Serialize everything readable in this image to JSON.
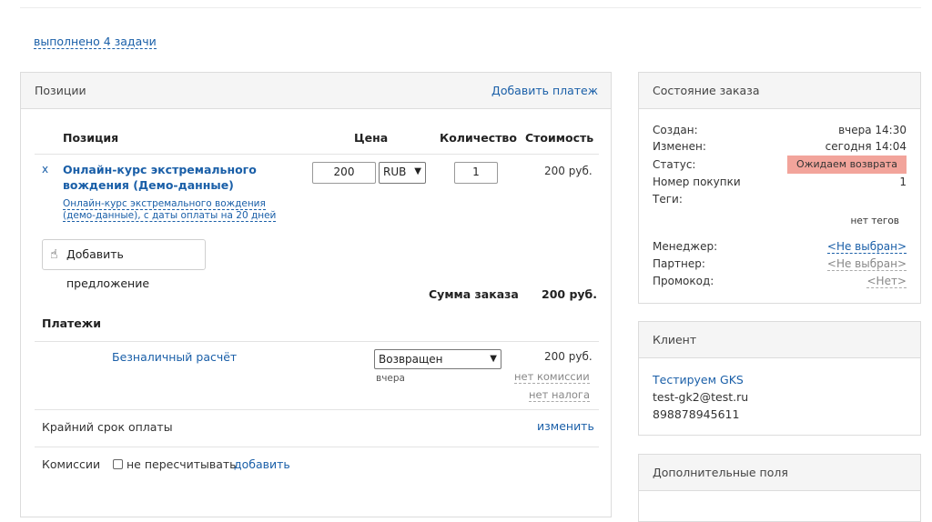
{
  "tasks_link": "выполнено 4 задачи",
  "positions": {
    "title": "Позиции",
    "add_payment": "Добавить платеж",
    "headers": {
      "position": "Позиция",
      "price": "Цена",
      "quantity": "Количество",
      "cost": "Стоимость"
    },
    "item": {
      "remove": "x",
      "name": "Онлайн-курс экстремального вождения (Демо-данные)",
      "description": "Онлайн-курс экстремального вождения (демо-данные), с даты оплаты на 20 дней",
      "price": "200",
      "currency": "RUB",
      "quantity": "1",
      "cost": "200 руб."
    },
    "add_offer": "Добавить предложение",
    "total_label": "Сумма заказа",
    "total_value": "200 руб."
  },
  "payments": {
    "title": "Платежи",
    "method": "Безналичный расчёт",
    "status": "Возвращен",
    "date": "вчера",
    "amount": "200 руб.",
    "commission": "нет комиссии",
    "tax": "нет налога"
  },
  "deadline": {
    "label": "Крайний срок оплаты",
    "action": "изменить"
  },
  "commissions": {
    "label": "Комиссии",
    "checkbox_label": "не пересчитывать",
    "add": "добавить"
  },
  "order_state": {
    "title": "Состояние заказа",
    "created_label": "Создан:",
    "created_value": "вчера 14:30",
    "changed_label": "Изменен:",
    "changed_value": "сегодня 14:04",
    "status_label": "Статус:",
    "status_value": "Ожидаем возврата",
    "purchase_label": "Номер покупки",
    "purchase_value": "1",
    "tags_label": "Теги:",
    "tags_value": "нет тегов",
    "manager_label": "Менеджер:",
    "manager_value": "<Не выбран>",
    "partner_label": "Партнер:",
    "partner_value": "<Не выбран>",
    "promo_label": "Промокод:",
    "promo_value": "<Нет>",
    "status_color": "#f2a49b"
  },
  "client": {
    "title": "Клиент",
    "name": "Тестируем GKS",
    "email": "test-gk2@test.ru",
    "phone": "898878945611"
  },
  "extra_fields": {
    "title": "Дополнительные поля"
  }
}
